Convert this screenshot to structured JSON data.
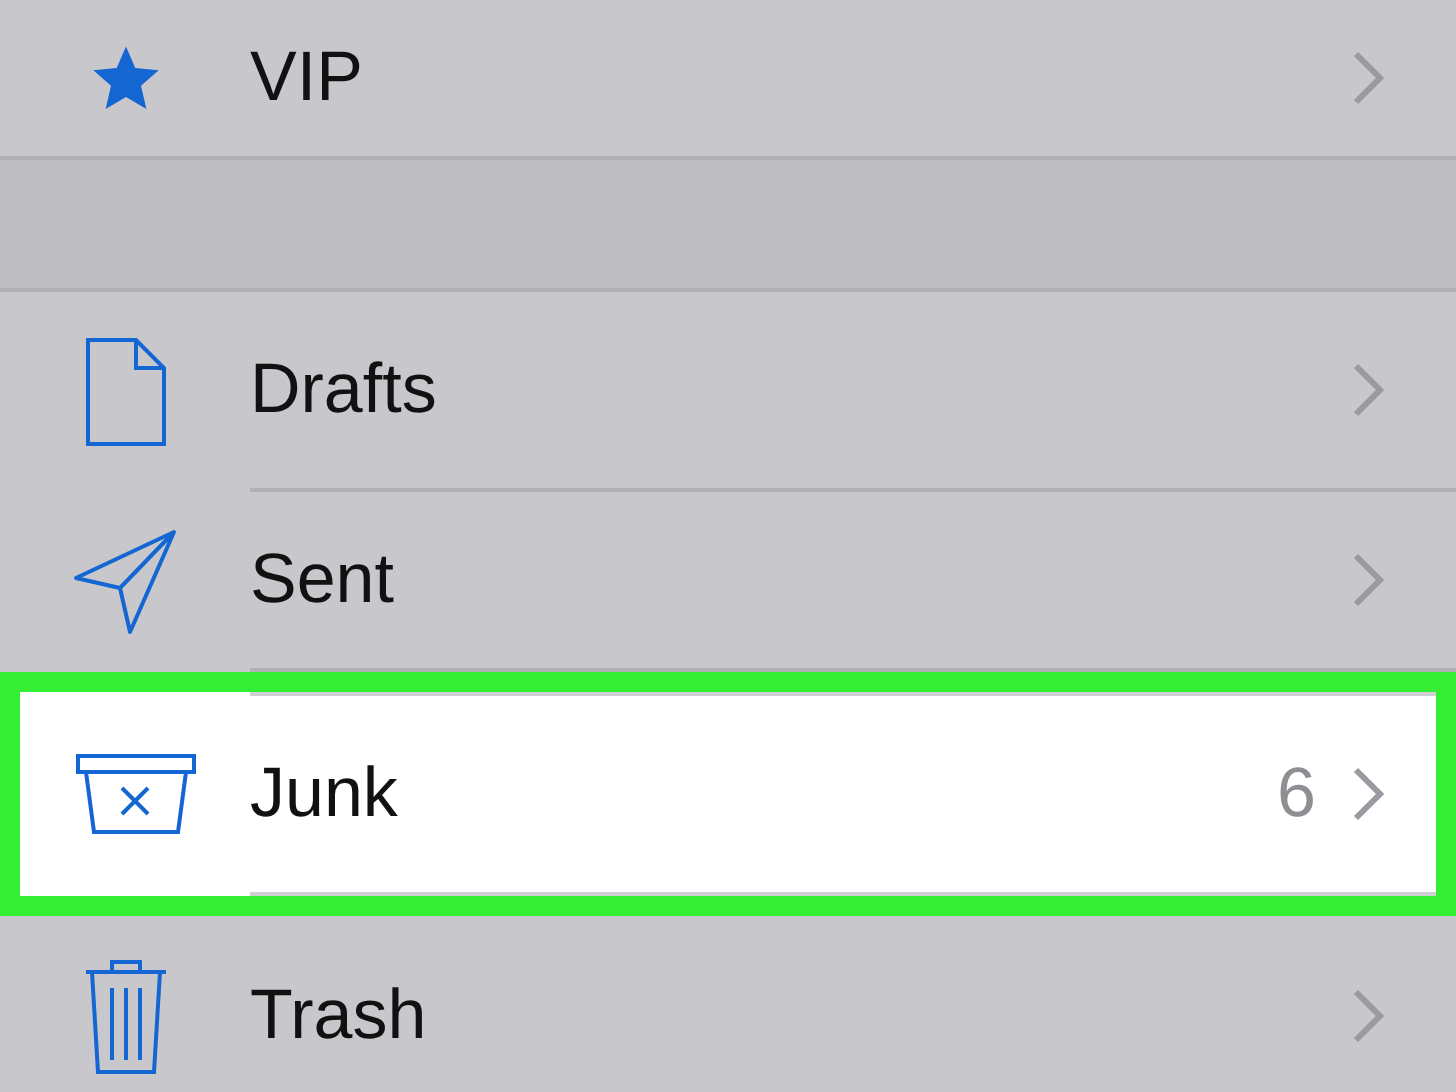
{
  "mailboxes_top": [
    {
      "label": "VIP",
      "kind": "star",
      "selected": false
    }
  ],
  "mailboxes": [
    {
      "label": "Drafts",
      "kind": "draft",
      "selected": false
    },
    {
      "label": "Sent",
      "kind": "sent",
      "selected": false
    },
    {
      "label": "Junk",
      "kind": "junk",
      "count": "6",
      "selected": true
    },
    {
      "label": "Trash",
      "kind": "trash",
      "selected": false
    }
  ]
}
